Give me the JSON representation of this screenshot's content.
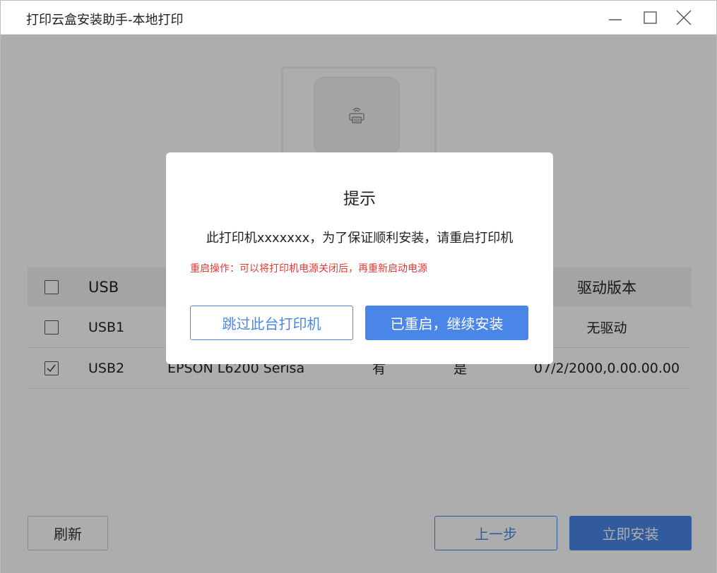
{
  "window": {
    "title": "打印云盒安装助手-本地打印"
  },
  "table": {
    "headers": {
      "port": "USB",
      "version": "驱动版本"
    },
    "rows": [
      {
        "port": "USB1",
        "name": "",
        "driver": "",
        "default": "",
        "version": "无驱动",
        "checked": false
      },
      {
        "port": "USB2",
        "name": "EPSON L6200 Serisa",
        "driver": "有",
        "default": "是",
        "version": "07/2/2000,0.00.00.00",
        "checked": true
      }
    ]
  },
  "footer": {
    "refresh_label": "刷新",
    "prev_label": "上一步",
    "install_label": "立即安装"
  },
  "modal": {
    "title": "提示",
    "message": "此打印机xxxxxxx，为了保证顺利安装，请重启打印机",
    "note": "重启操作：可以将打印机电源关闭后，再重新启动电源",
    "skip_label": "跳过此台打印机",
    "restarted_label": "已重启，继续安装"
  },
  "colors": {
    "accent": "#4a86e8",
    "warning": "#e53935",
    "overlay": "rgba(0,0,0,0.32)"
  },
  "icons": [
    "minimize-icon",
    "maximize-icon",
    "close-icon",
    "printer-cloud-icon",
    "checkmark-icon"
  ]
}
